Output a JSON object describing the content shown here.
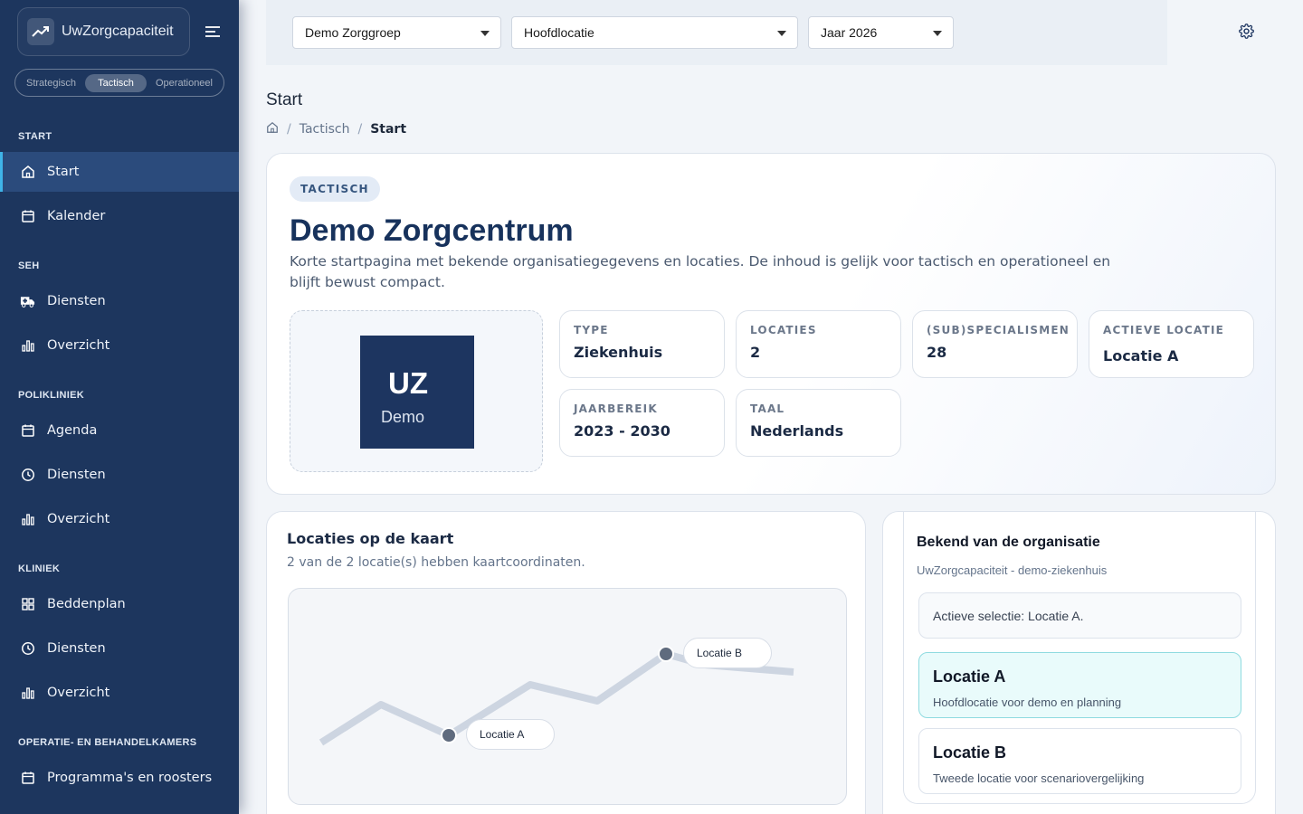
{
  "app": {
    "name": "UwZorgcapaciteit"
  },
  "mode_switch": {
    "options": [
      "Strategisch",
      "Tactisch",
      "Operationeel"
    ],
    "selected": "Tactisch"
  },
  "sidebar": {
    "sections": [
      {
        "title": "START",
        "items": [
          {
            "label": "Start",
            "icon": "home-icon",
            "active": true
          },
          {
            "label": "Kalender",
            "icon": "calendar-icon"
          }
        ]
      },
      {
        "title": "SEH",
        "items": [
          {
            "label": "Diensten",
            "icon": "ambulance-icon"
          },
          {
            "label": "Overzicht",
            "icon": "bar-chart-icon"
          }
        ]
      },
      {
        "title": "POLIKLINIEK",
        "items": [
          {
            "label": "Agenda",
            "icon": "calendar-icon"
          },
          {
            "label": "Diensten",
            "icon": "clock-icon"
          },
          {
            "label": "Overzicht",
            "icon": "bar-chart-icon"
          }
        ]
      },
      {
        "title": "KLINIEK",
        "items": [
          {
            "label": "Beddenplan",
            "icon": "grid-icon"
          },
          {
            "label": "Diensten",
            "icon": "clock-icon"
          },
          {
            "label": "Overzicht",
            "icon": "bar-chart-icon"
          }
        ]
      },
      {
        "title": "OPERATIE- EN BEHANDELKAMERS",
        "items": [
          {
            "label": "Programma's en roosters",
            "icon": "calendar-icon"
          }
        ]
      }
    ]
  },
  "filters": {
    "organisation": "Demo Zorggroep",
    "location": "Hoofdlocatie",
    "year": "Jaar 2026"
  },
  "page": {
    "title": "Start"
  },
  "breadcrumb": {
    "middle": "Tactisch",
    "current": "Start"
  },
  "hero": {
    "badge": "TACTISCH",
    "title": "Demo Zorgcentrum",
    "description": "Korte startpagina met bekende organisatiegegevens en locaties. De inhoud is gelijk voor tactisch en operationeel en blijft bewust compact.",
    "logo": {
      "initials": "UZ",
      "subtitle": "Demo"
    },
    "info": [
      {
        "label": "TYPE",
        "value": "Ziekenhuis"
      },
      {
        "label": "LOCATIES",
        "value": "2"
      },
      {
        "label": "(SUB)SPECIALISMEN",
        "value": "28"
      },
      {
        "label": "ACTIEVE LOCATIE",
        "value": "Locatie A"
      },
      {
        "label": "JAARBEREIK",
        "value": "2023 - 2030"
      },
      {
        "label": "TAAL",
        "value": "Nederlands"
      }
    ]
  },
  "map": {
    "title": "Locaties op de kaart",
    "subtitle": "2 van de 2 locatie(s) hebben kaartcoordinaten.",
    "markers": [
      {
        "label": "Locatie A"
      },
      {
        "label": "Locatie B"
      }
    ]
  },
  "org": {
    "title": "Bekend van de organisatie",
    "subtitle": "UwZorgcapaciteit - demo-ziekenhuis",
    "selection": "Actieve selectie: Locatie A.",
    "locations": [
      {
        "name": "Locatie A",
        "description": "Hoofdlocatie voor demo en planning",
        "active": true
      },
      {
        "name": "Locatie B",
        "description": "Tweede locatie voor scenariovergelijking",
        "active": false
      }
    ]
  },
  "colors": {
    "sidebar": "#1d365e",
    "active_item": "#2b4b7c",
    "accent": "#3fb4e8",
    "brand_dark": "#1d3560",
    "active_location_bg": "#e9fbfb"
  }
}
